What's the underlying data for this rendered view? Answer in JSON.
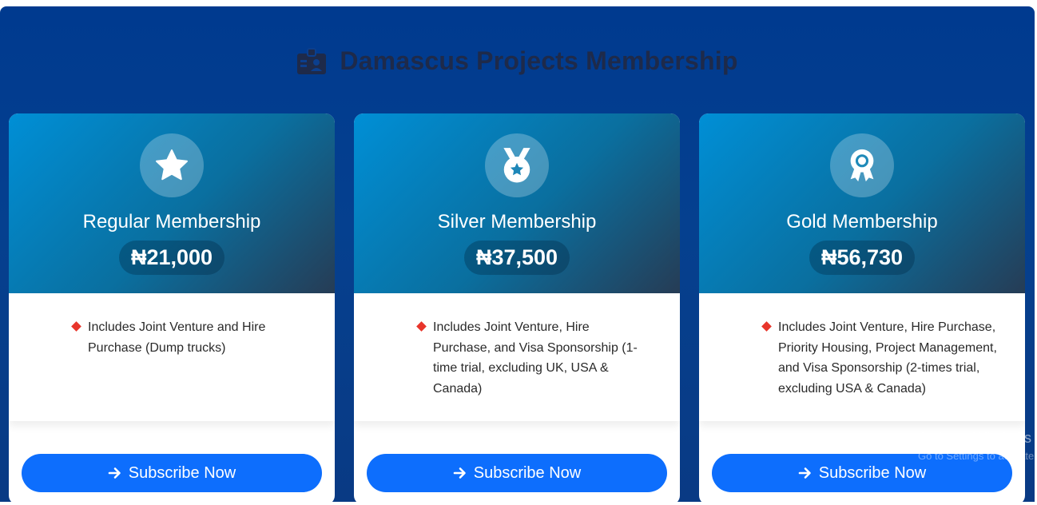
{
  "header": {
    "icon": "id-badge-icon",
    "title": "Damascus Projects Membership"
  },
  "plans": [
    {
      "icon": "star-icon",
      "title": "Regular Membership",
      "price": "₦21,000",
      "feature": "Includes Joint Venture and Hire Purchase (Dump trucks)",
      "button": "Subscribe Now"
    },
    {
      "icon": "medal-icon",
      "title": "Silver Membership",
      "price": "₦37,500",
      "feature": "Includes Joint Venture, Hire Purchase, and Visa Sponsorship (1-time trial, excluding UK, USA & Canada)",
      "button": "Subscribe Now"
    },
    {
      "icon": "award-icon",
      "title": "Gold Membership",
      "price": "₦56,730",
      "feature": "Includes Joint Venture, Hire Purchase, Priority Housing, Project Management, and Visa Sponsorship (2-times trial, excluding USA & Canada)",
      "button": "Subscribe Now"
    }
  ],
  "watermark": {
    "title": "Activate Windows",
    "subtitle": "Go to Settings to activate Windows."
  },
  "colors": {
    "background": "#003a8f",
    "button": "#0d6efd",
    "bullet": "#e8352b",
    "accent_gradient_start": "#008fd6",
    "accent_gradient_end": "#263c55"
  }
}
